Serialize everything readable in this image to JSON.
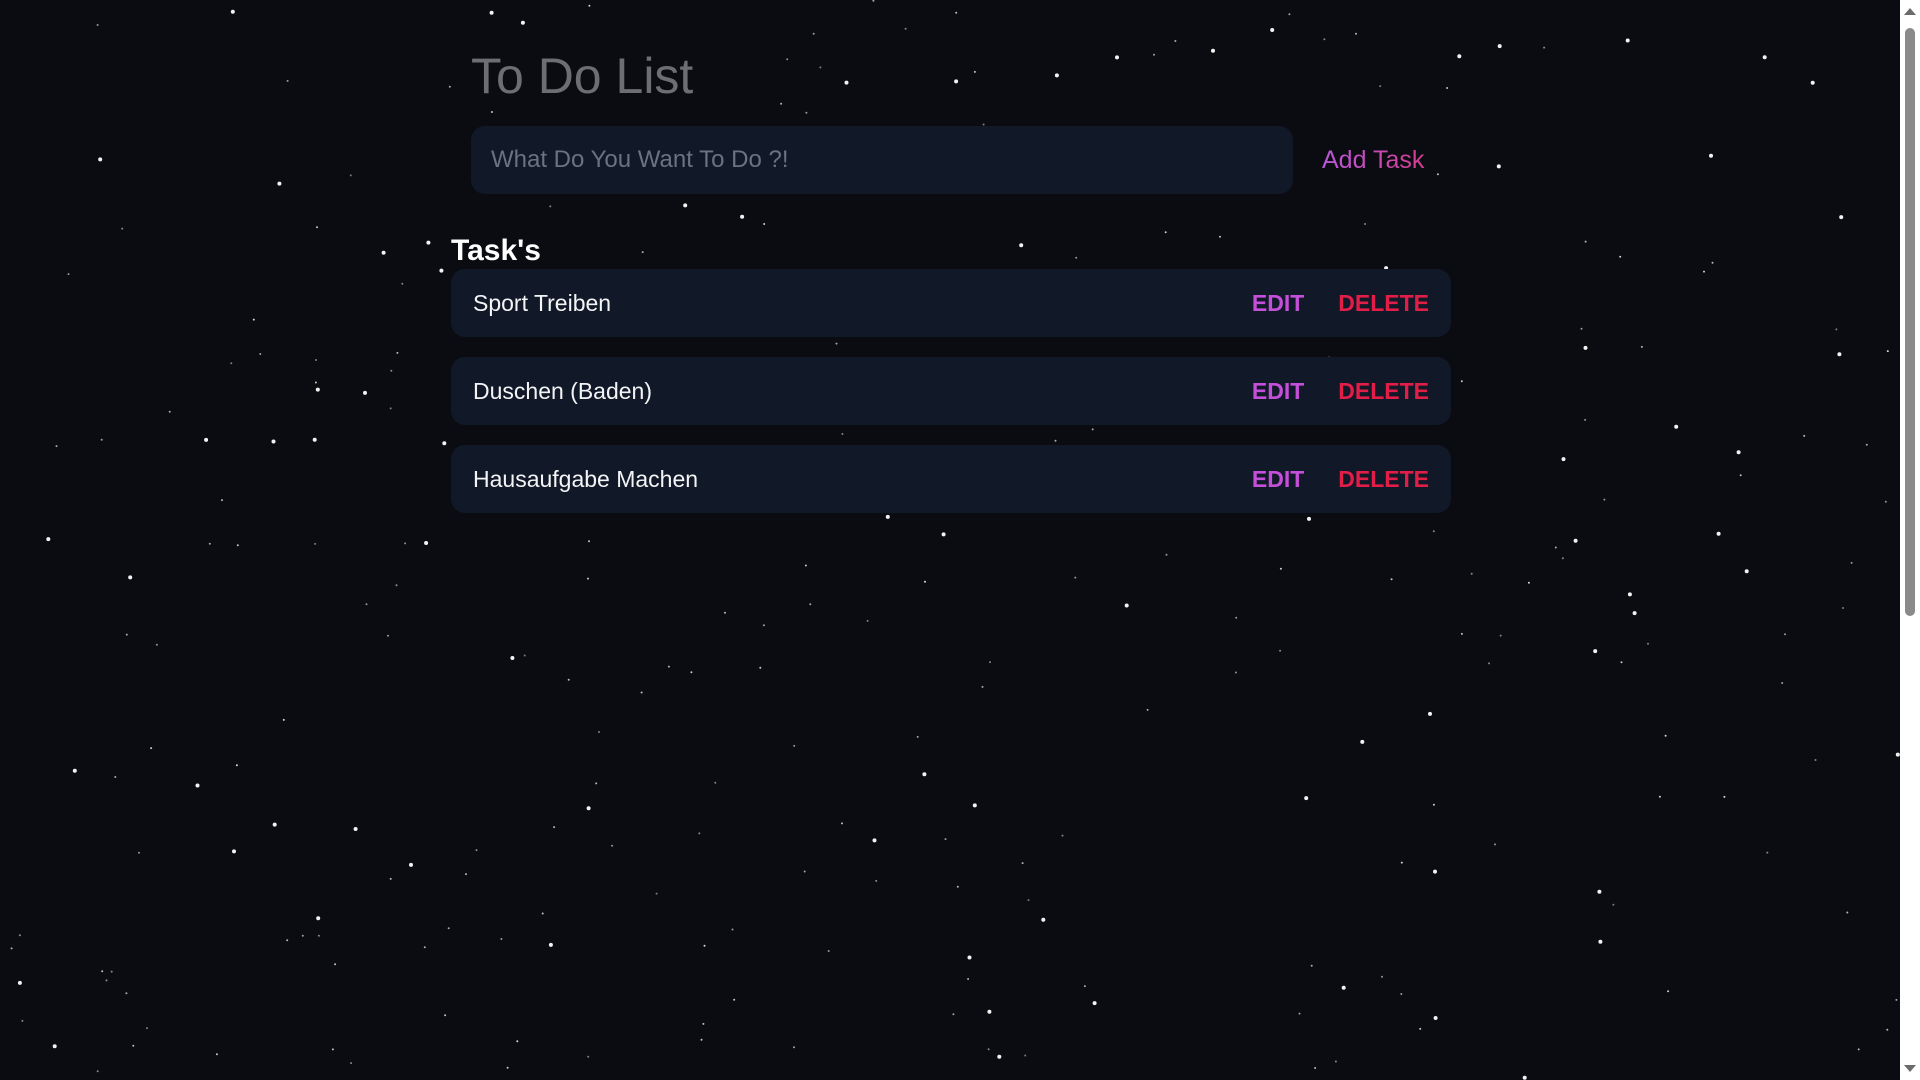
{
  "app": {
    "title": "To Do List"
  },
  "input": {
    "placeholder": "What Do You Want To Do ?!",
    "value": ""
  },
  "add_button": {
    "label": "Add Task"
  },
  "tasks_section": {
    "heading": "Task's",
    "items": [
      {
        "name": "Sport Treiben",
        "edit_label": "EDIT",
        "delete_label": "DELETE"
      },
      {
        "name": "Duschen (Baden)",
        "edit_label": "EDIT",
        "delete_label": "DELETE"
      },
      {
        "name": "Hausaufgabe Machen",
        "edit_label": "EDIT",
        "delete_label": "DELETE"
      }
    ]
  },
  "colors": {
    "background": "#0b0c11",
    "card": "#111827",
    "title": "#6c6e73",
    "edit": "#c44fd8",
    "delete": "#e11d48",
    "add_gradient_start": "#b658e0",
    "add_gradient_end": "#d63c8a",
    "stars": "#ffffff"
  },
  "icons": {
    "scroll_up": "triangle-up-icon",
    "scroll_down": "triangle-down-icon"
  }
}
